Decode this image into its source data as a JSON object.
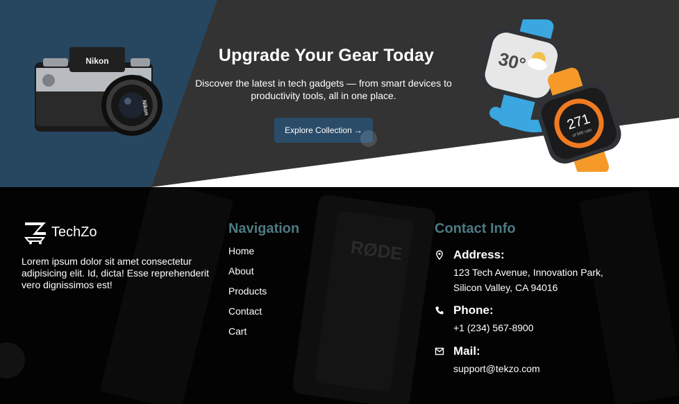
{
  "hero": {
    "title": "Upgrade Your Gear Today",
    "description": "Discover the latest in tech gadgets — from smart devices to productivity tools, all in one place.",
    "cta_label": "Explore Collection",
    "cta_icon": "arrow-right-icon",
    "images": {
      "camera_brand": "Nikon",
      "watch_temperature": "30°",
      "watch_steps": "271",
      "watch_steps_caption": "of 500 cals"
    }
  },
  "footer": {
    "brand": {
      "name": "TechZo",
      "description": "Lorem ipsum dolor sit amet consectetur adipisicing elit. Id, dicta! Esse reprehenderit vero dignissimos est!"
    },
    "background_label": "RØDE",
    "navigation": {
      "title": "Navigation",
      "items": [
        "Home",
        "About",
        "Products",
        "Contact",
        "Cart"
      ]
    },
    "contact": {
      "title": "Contact Info",
      "address": {
        "label": "Address:",
        "line1": "123 Tech Avenue, Innovation Park,",
        "line2": "Silicon Valley, CA 94016",
        "icon": "map-pin-icon"
      },
      "phone": {
        "label": "Phone:",
        "value": "+1 (234) 567-8900",
        "icon": "phone-icon"
      },
      "mail": {
        "label": "Mail:",
        "value": "support@tekzo.com",
        "icon": "mail-icon"
      }
    }
  },
  "colors": {
    "hero_dark": "#333333",
    "hero_blue": "#2b4c68",
    "footer_bg": "#020202",
    "heading_teal": "#4d7a82"
  }
}
